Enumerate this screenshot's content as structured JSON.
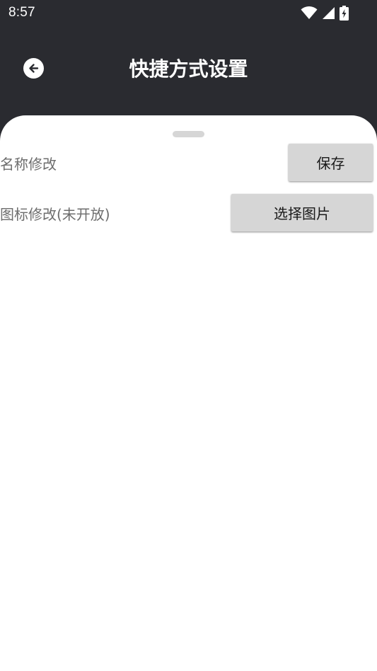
{
  "status_bar": {
    "time": "8:57",
    "icons": [
      "wifi-icon",
      "cell-signal-icon",
      "battery-charging-icon"
    ]
  },
  "header": {
    "title": "快捷方式设置",
    "back_icon": "arrow-left-icon"
  },
  "settings": {
    "name_row": {
      "label": "名称修改",
      "button_label": "保存"
    },
    "icon_row": {
      "label": "图标修改(未开放)",
      "button_label": "选择图片"
    }
  },
  "colors": {
    "header_background": "#2a2b30",
    "sheet_background": "#ffffff",
    "button_background": "#d6d6d6",
    "label_text": "#6d6d6d"
  }
}
